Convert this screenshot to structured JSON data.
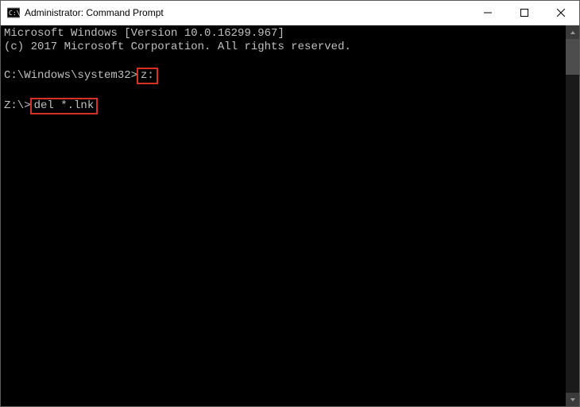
{
  "window": {
    "title": "Administrator: Command Prompt"
  },
  "console": {
    "line1": "Microsoft Windows [Version 10.0.16299.967]",
    "line2": "(c) 2017 Microsoft Corporation. All rights reserved.",
    "prompt1": "C:\\Windows\\system32>",
    "cmd1": "z:",
    "prompt2": "Z:\\>",
    "cmd2": "del *.lnk"
  },
  "colors": {
    "highlight": "#d93025",
    "console_bg": "#000000",
    "console_fg": "#c0c0c0"
  }
}
